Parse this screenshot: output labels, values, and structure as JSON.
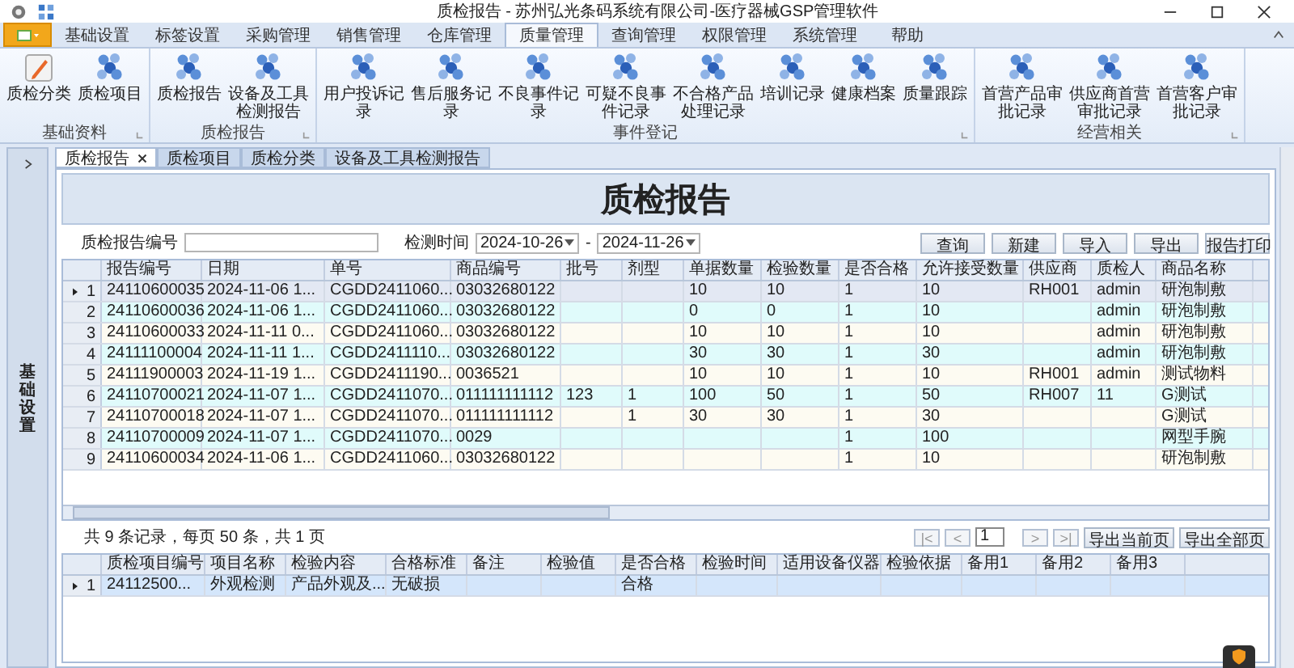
{
  "window": {
    "title": "质检报告 - 苏州弘光条码系统有限公司-医疗器械GSP管理软件"
  },
  "menu_tabs": [
    {
      "label": "基础设置",
      "selected": false
    },
    {
      "label": "标签设置",
      "selected": false
    },
    {
      "label": "采购管理",
      "selected": false
    },
    {
      "label": "销售管理",
      "selected": false
    },
    {
      "label": "仓库管理",
      "selected": false
    },
    {
      "label": "质量管理",
      "selected": true
    },
    {
      "label": "查询管理",
      "selected": false
    },
    {
      "label": "权限管理",
      "selected": false
    },
    {
      "label": "系统管理",
      "selected": false
    },
    {
      "label": "帮助",
      "selected": false
    }
  ],
  "ribbon_groups": [
    {
      "label": "基础资料",
      "items": [
        {
          "label": "质检分类",
          "kind": "pencil"
        },
        {
          "label": "质检项目",
          "kind": "cluster"
        }
      ]
    },
    {
      "label": "质检报告",
      "items": [
        {
          "label": "质检报告",
          "kind": "cluster"
        },
        {
          "label": "设备及工具检测报告",
          "kind": "cluster"
        }
      ]
    },
    {
      "label": "事件登记",
      "items": [
        {
          "label": "用户投诉记录",
          "kind": "cluster"
        },
        {
          "label": "售后服务记录",
          "kind": "cluster"
        },
        {
          "label": "不良事件记录",
          "kind": "cluster"
        },
        {
          "label": "可疑不良事件记录",
          "kind": "cluster"
        },
        {
          "label": "不合格产品处理记录",
          "kind": "cluster"
        },
        {
          "label": "培训记录",
          "kind": "cluster"
        },
        {
          "label": "健康档案",
          "kind": "cluster"
        },
        {
          "label": "质量跟踪",
          "kind": "cluster"
        }
      ]
    },
    {
      "label": "经营相关",
      "items": [
        {
          "label": "首营产品审批记录",
          "kind": "cluster"
        },
        {
          "label": "供应商首营审批记录",
          "kind": "cluster"
        },
        {
          "label": "首营客户审批记录",
          "kind": "cluster"
        }
      ]
    }
  ],
  "sidebar": {
    "label": "基础设置"
  },
  "doc_tabs": [
    {
      "label": "质检报告",
      "selected": true
    },
    {
      "label": "质检项目",
      "selected": false
    },
    {
      "label": "质检分类",
      "selected": false
    },
    {
      "label": "设备及工具检测报告",
      "selected": false
    }
  ],
  "banner_title": "质检报告",
  "filter": {
    "report_no_label": "质检报告编号",
    "date_label": "检测时间",
    "date_from": "2024-10-26",
    "date_sep": "-",
    "date_to": "2024-11-26"
  },
  "buttons": [
    "查询",
    "新建",
    "导入",
    "导出",
    "报告打印"
  ],
  "table": {
    "columns": [
      "报告编号",
      "日期",
      "单号",
      "商品编号",
      "批号",
      "剂型",
      "单据数量",
      "检验数量",
      "是否合格",
      "允许接受数量",
      "供应商",
      "质检人",
      "商品名称"
    ],
    "rows": [
      {
        "index": "1",
        "selected": true,
        "cells": [
          "24110600035",
          "2024-11-06 1...",
          "CGDD2411060...",
          "03032680122",
          null,
          null,
          "10",
          "10",
          "1",
          "10",
          "RH001",
          "admin",
          "研泡制敷"
        ]
      },
      {
        "index": "2",
        "selected": false,
        "cells": [
          "24110600036",
          "2024-11-06 1...",
          "CGDD2411060...",
          "03032680122",
          null,
          null,
          "0",
          "0",
          "1",
          "10",
          null,
          "admin",
          "研泡制敷"
        ]
      },
      {
        "index": "3",
        "selected": false,
        "cells": [
          "24110600033",
          "2024-11-11 0...",
          "CGDD2411060...",
          "03032680122",
          null,
          null,
          "10",
          "10",
          "1",
          "10",
          null,
          "admin",
          "研泡制敷"
        ]
      },
      {
        "index": "4",
        "selected": false,
        "cells": [
          "24111100004",
          "2024-11-11 1...",
          "CGDD2411110...",
          "03032680122",
          null,
          null,
          "30",
          "30",
          "1",
          "30",
          null,
          "admin",
          "研泡制敷"
        ]
      },
      {
        "index": "5",
        "selected": false,
        "cells": [
          "24111900003",
          "2024-11-19 1...",
          "CGDD2411190...",
          "0036521",
          null,
          null,
          "10",
          "10",
          "1",
          "10",
          "RH001",
          "admin",
          "测试物料"
        ]
      },
      {
        "index": "6",
        "selected": false,
        "cells": [
          "24110700021",
          "2024-11-07 1...",
          "CGDD2411070...",
          "011111111112",
          "123",
          "1",
          "100",
          "50",
          "1",
          "50",
          "RH007",
          "11",
          "G测试"
        ]
      },
      {
        "index": "7",
        "selected": false,
        "cells": [
          "24110700018",
          "2024-11-07 1...",
          "CGDD2411070...",
          "011111111112",
          null,
          "1",
          "30",
          "30",
          "1",
          "30",
          null,
          null,
          "G测试"
        ]
      },
      {
        "index": "8",
        "selected": false,
        "cells": [
          "24110700009",
          "2024-11-07 1...",
          "CGDD2411070...",
          "0029",
          null,
          null,
          null,
          null,
          "1",
          "100",
          null,
          null,
          "网型手腕"
        ]
      },
      {
        "index": "9",
        "selected": false,
        "cells": [
          "24110600034",
          "2024-11-06 1...",
          "CGDD2411060...",
          "03032680122",
          null,
          null,
          null,
          null,
          "1",
          "10",
          null,
          null,
          "研泡制敷"
        ]
      }
    ]
  },
  "pager": {
    "summary": "共 9 条记录，每页 50 条，共 1 页",
    "nav_before": [
      {
        "label": "|<",
        "disabled": true
      },
      {
        "label": "<",
        "disabled": true
      }
    ],
    "page": "1",
    "nav_after": [
      {
        "label": ">",
        "disabled": true
      },
      {
        "label": ">|",
        "disabled": true
      }
    ],
    "buttons": [
      "导出当前页",
      "导出全部页"
    ]
  },
  "detail_table": {
    "columns": [
      "质检项目编号",
      "项目名称",
      "检验内容",
      "合格标准",
      "备注",
      "检验值",
      "是否合格",
      "检验时间",
      "适用设备仪器",
      "检验依据",
      "备用1",
      "备用2",
      "备用3"
    ],
    "rows": [
      {
        "index": "1",
        "selected": true,
        "cells": [
          "24112500...",
          "外观检测",
          "产品外观及...",
          "无破损",
          null,
          null,
          "合格",
          null,
          null,
          null,
          null,
          null,
          null
        ]
      }
    ]
  }
}
